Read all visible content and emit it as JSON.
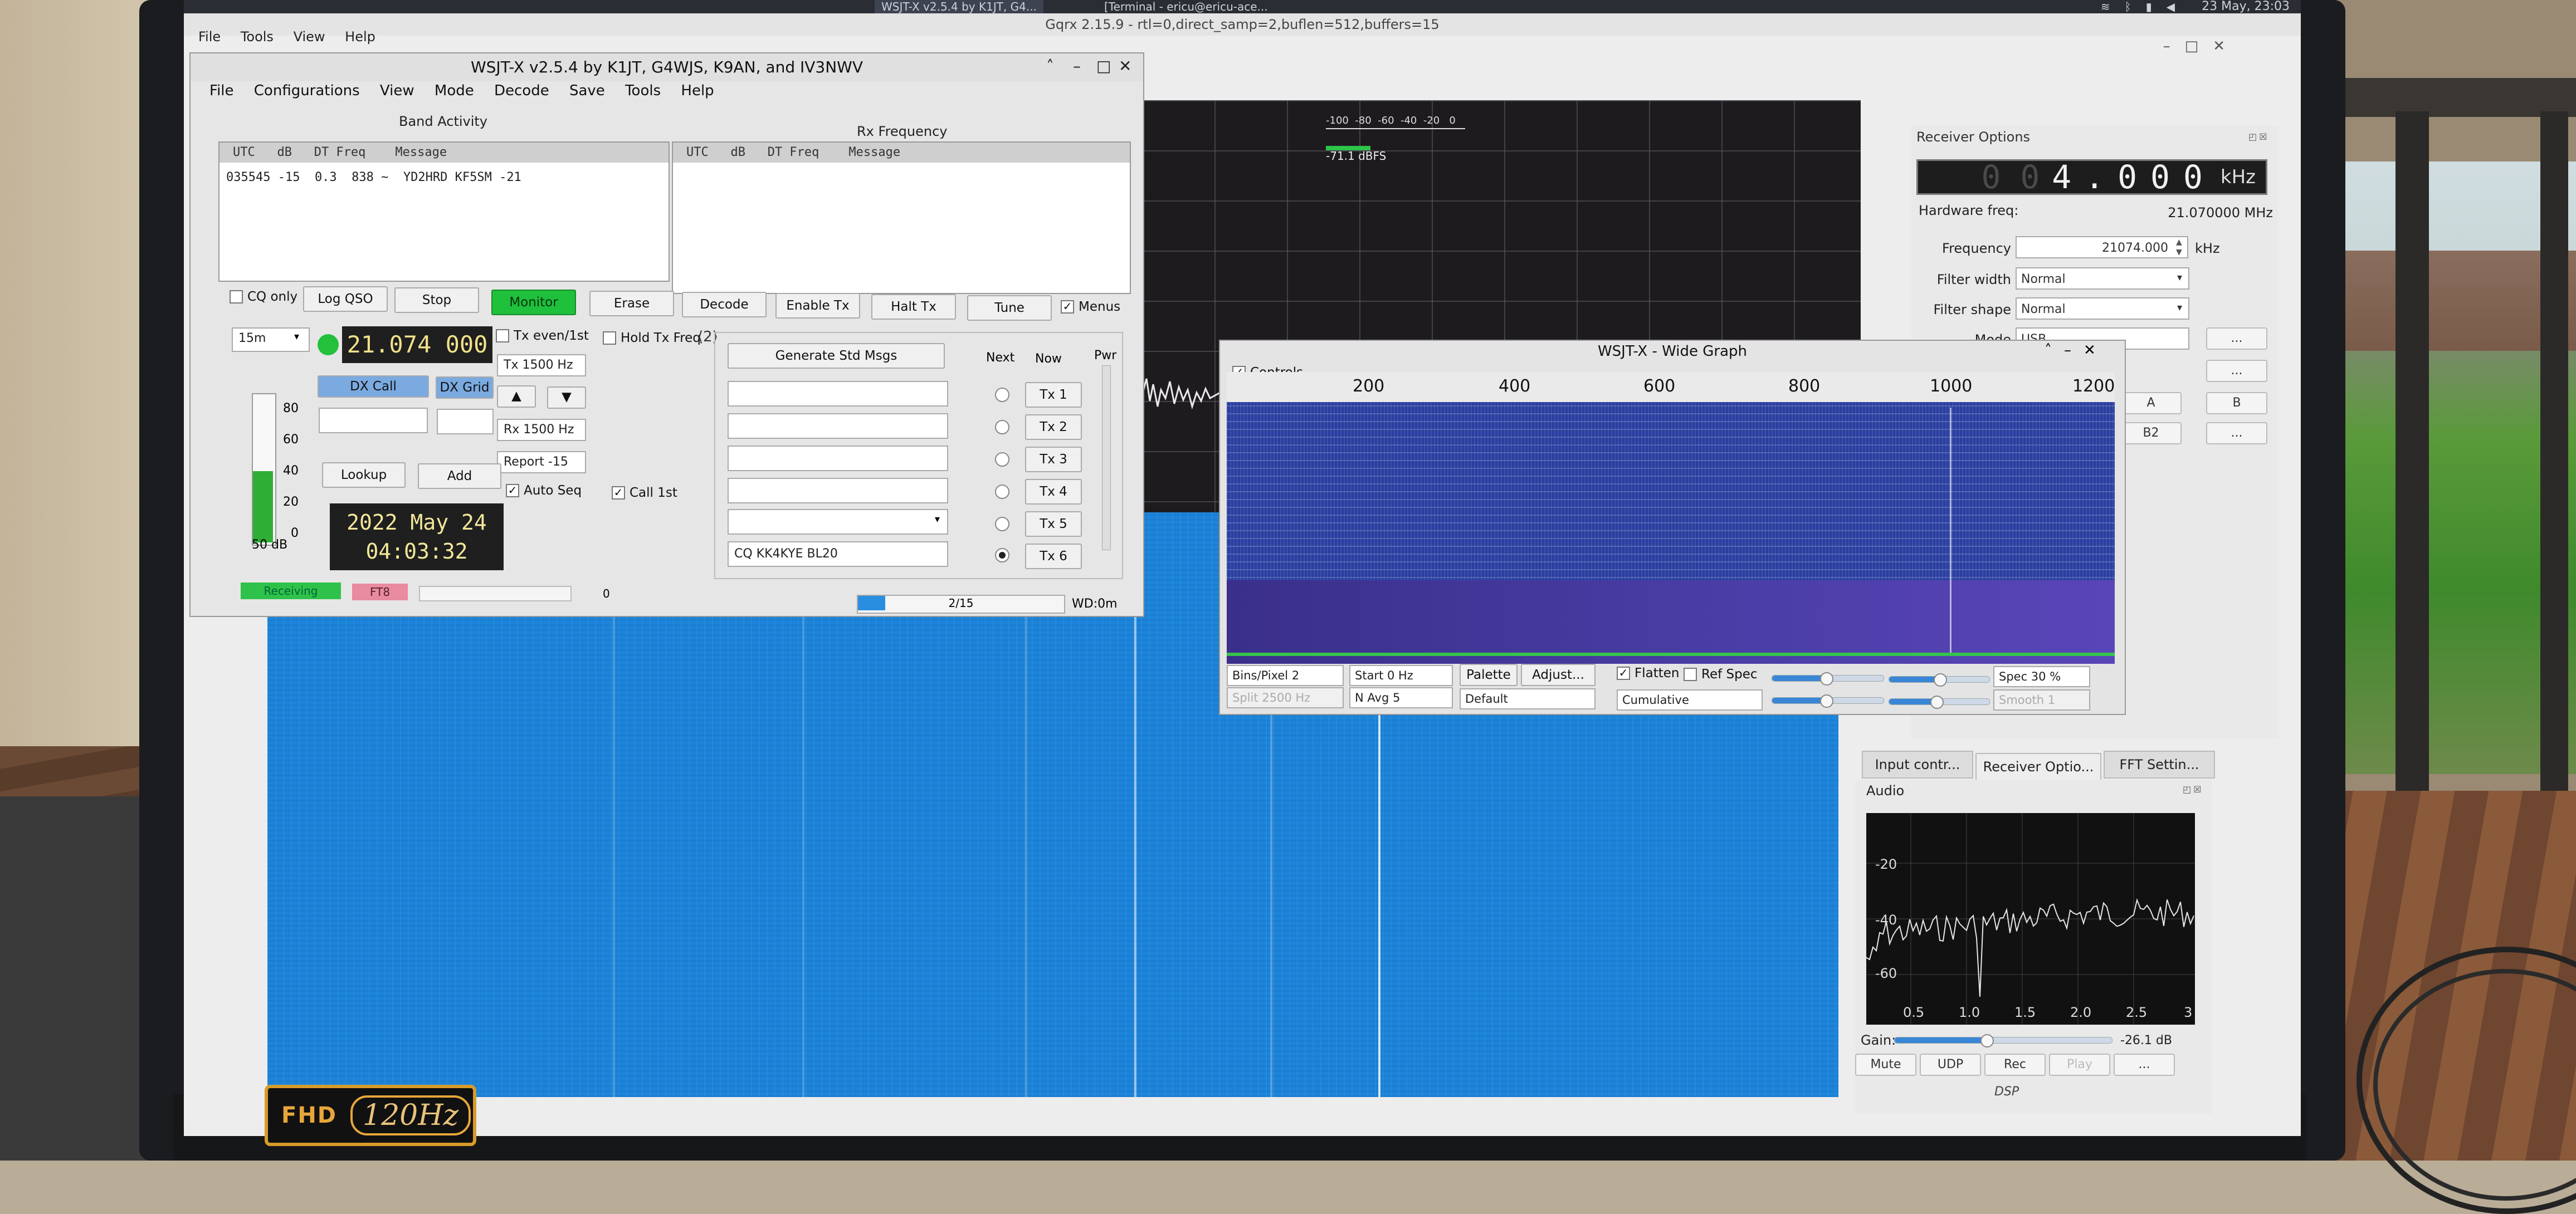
{
  "taskbar": {
    "tasks": [
      "WSJT-X  v2.5.4  by K1JT, G4...",
      "[Terminal - ericu@ericu-ace..."
    ],
    "clock": "23 May, 23:03",
    "tray_icons": [
      "wifi-icon",
      "bluetooth-icon",
      "volume-icon",
      "battery-icon"
    ]
  },
  "gqrx": {
    "title": "Gqrx 2.15.9 - rtl=0,direct_samp=2,buflen=512,buffers=15",
    "menu": [
      "File",
      "Tools",
      "View",
      "Help"
    ],
    "meter": {
      "scale": "-100  -80  -60  -40  -20   0",
      "readout": "-71.1 dBFS"
    },
    "receiver_options": {
      "title": "Receiver Options",
      "offset_dim": "0 0",
      "offset_digits": "4.000",
      "offset_unit": "kHz",
      "hardware_freq_label": "Hardware freq:",
      "hardware_freq_value": "21.070000 MHz",
      "frequency_label": "Frequency",
      "frequency_value": "21074.000",
      "frequency_unit": "kHz",
      "filter_width_label": "Filter width",
      "filter_width_value": "Normal",
      "filter_shape_label": "Filter shape",
      "filter_shape_value": "Normal",
      "mode_label": "Mode",
      "mode_value": "USB",
      "ellipsis": "...",
      "btn_a": "A",
      "btn_b": "B",
      "btn_b2": "B2"
    },
    "tabs": [
      "Input contr...",
      "Receiver Optio...",
      "FFT Settin..."
    ],
    "audio": {
      "title": "Audio",
      "y_ticks": [
        "-20",
        "-40",
        "-60"
      ],
      "x_ticks": [
        "0.5",
        "1.0",
        "1.5",
        "2.0",
        "2.5",
        "3"
      ],
      "gain_label": "Gain:",
      "gain_value": "-26.1 dB",
      "gain_level": 0.42,
      "buttons": [
        "Mute",
        "UDP",
        "Rec",
        "Play",
        "..."
      ],
      "dsp_label": "DSP"
    }
  },
  "wsjtx": {
    "title": "WSJT-X   v2.5.4   by K1JT, G4WJS, K9AN, and IV3NWV",
    "menu": [
      "File",
      "Configurations",
      "View",
      "Mode",
      "Decode",
      "Save",
      "Tools",
      "Help"
    ],
    "band_activity": {
      "heading": "Band Activity",
      "columns": "UTC   dB   DT Freq    Message",
      "lines": [
        "035545 -15  0.3  838 ~  YD2HRD KF5SM -21"
      ]
    },
    "rx_frequency": {
      "heading": "Rx Frequency",
      "columns": "UTC   dB   DT Freq    Message"
    },
    "controls": {
      "cq_only": "CQ only",
      "log_qso": "Log QSO",
      "stop": "Stop",
      "monitor": "Monitor",
      "erase": "Erase",
      "decode": "Decode",
      "enable_tx": "Enable Tx",
      "halt_tx": "Halt Tx",
      "tune": "Tune",
      "menus": "Menus"
    },
    "band": "15m",
    "dial_freq": "21.074 000",
    "tx_even": "Tx even/1st",
    "hold_tx_freq": "Hold Tx Freq",
    "tx_freq": "Tx  1500 Hz",
    "rx_freq": "Rx  1500 Hz",
    "report": "Report -15",
    "auto_seq": "Auto Seq",
    "call_1st": "Call 1st",
    "dx_call_label": "DX Call",
    "dx_grid_label": "DX Grid",
    "lookup": "Lookup",
    "add": "Add",
    "level_ticks": [
      "80",
      "60",
      "40",
      "20",
      "0"
    ],
    "level_db": "50 dB",
    "date": "2022 May 24",
    "time": "04:03:32",
    "gen_std_msgs": "Generate Std Msgs",
    "next_label": "Next",
    "now_label": "Now",
    "pwr_label": "Pwr",
    "tx_buttons": [
      "Tx 1",
      "Tx 2",
      "Tx 3",
      "Tx 4",
      "Tx 5",
      "Tx 6"
    ],
    "tx6_message": "CQ KK4KYE BL20",
    "status_receiving": "Receiving",
    "status_mode": "FT8",
    "status_zero": "0",
    "progress_text": "2/15",
    "progress_fraction": 0.133,
    "wd": "WD:0m"
  },
  "wide_graph": {
    "title": "WSJT-X - Wide Graph",
    "controls_label": "Controls",
    "scale_ticks": [
      "200",
      "400",
      "600",
      "800",
      "1000",
      "1200"
    ],
    "bins_per_pixel": "Bins/Pixel  2",
    "start": "Start 0 Hz",
    "palette": "Palette",
    "adjust": "Adjust...",
    "flatten": "Flatten",
    "ref_spec": "Ref Spec",
    "spec": "Spec 30 %",
    "split": "Split  2500  Hz",
    "navg": "N Avg 5",
    "palette_value": "Default",
    "mode_value": "Cumulative",
    "smooth": "Smooth  1"
  }
}
